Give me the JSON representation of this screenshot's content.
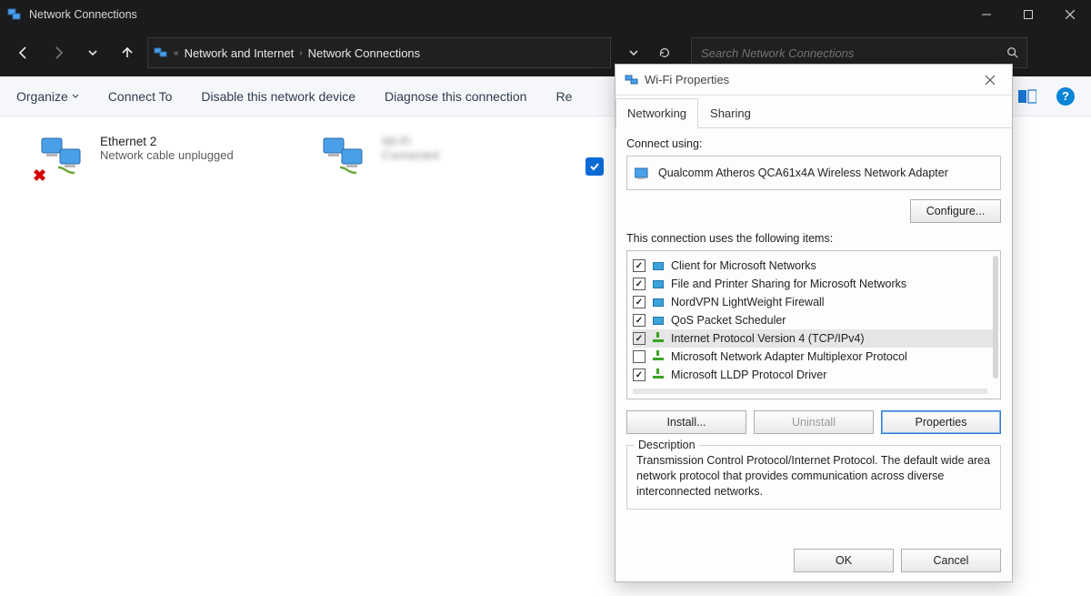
{
  "window": {
    "title": "Network Connections",
    "controls": {
      "minimize": "min",
      "maximize": "max",
      "close": "close"
    }
  },
  "nav": {
    "crumb_category": "Network and Internet",
    "crumb_page": "Network Connections",
    "search_placeholder": "Search Network Connections"
  },
  "toolbar": {
    "organize": "Organize",
    "connect_to": "Connect To",
    "disable": "Disable this network device",
    "diagnose": "Diagnose this connection",
    "rename_trunc": "Re"
  },
  "connections": {
    "ethernet": {
      "name": "Ethernet 2",
      "status": "Network cable unplugged"
    },
    "wifi": {
      "name": "Wi-Fi",
      "status": "Connected"
    },
    "selected_adapter_checked": true
  },
  "dialog": {
    "title": "Wi-Fi Properties",
    "tabs": {
      "networking": "Networking",
      "sharing": "Sharing"
    },
    "connect_using_label": "Connect using:",
    "adapter": "Qualcomm Atheros QCA61x4A Wireless Network Adapter",
    "configure_btn": "Configure...",
    "items_label": "This connection uses the following items:",
    "items": [
      {
        "checked": true,
        "icon": "mon",
        "label": "Client for Microsoft Networks"
      },
      {
        "checked": true,
        "icon": "mon",
        "label": "File and Printer Sharing for Microsoft Networks"
      },
      {
        "checked": true,
        "icon": "mon",
        "label": "NordVPN LightWeight Firewall"
      },
      {
        "checked": true,
        "icon": "mon",
        "label": "QoS Packet Scheduler"
      },
      {
        "checked": true,
        "icon": "bar",
        "label": "Internet Protocol Version 4 (TCP/IPv4)",
        "selected": true
      },
      {
        "checked": false,
        "icon": "bar",
        "label": "Microsoft Network Adapter Multiplexor Protocol"
      },
      {
        "checked": true,
        "icon": "bar",
        "label": "Microsoft LLDP Protocol Driver"
      }
    ],
    "install_btn": "Install...",
    "uninstall_btn": "Uninstall",
    "properties_btn": "Properties",
    "desc_heading": "Description",
    "desc_text": "Transmission Control Protocol/Internet Protocol. The default wide area network protocol that provides communication across diverse interconnected networks.",
    "ok_btn": "OK",
    "cancel_btn": "Cancel"
  }
}
